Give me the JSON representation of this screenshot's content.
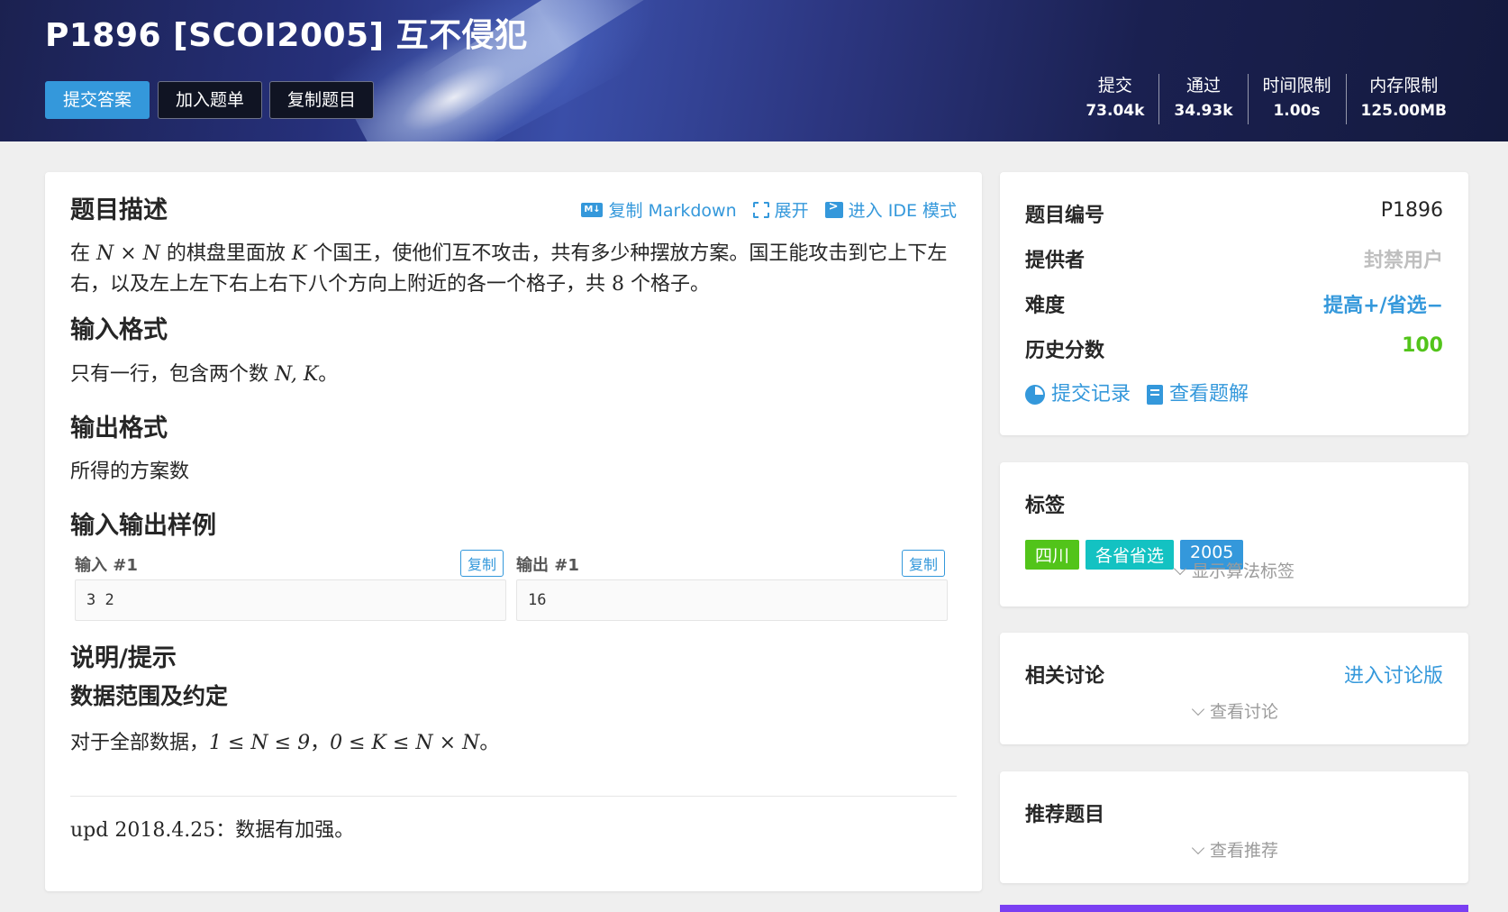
{
  "header": {
    "title": "P1896 [SCOI2005] 互不侵犯",
    "buttons": {
      "submit": "提交答案",
      "add_list": "加入题单",
      "copy": "复制题目"
    },
    "stats": [
      {
        "label": "提交",
        "value": "73.04k"
      },
      {
        "label": "通过",
        "value": "34.93k"
      },
      {
        "label": "时间限制",
        "value": "1.00s"
      },
      {
        "label": "内存限制",
        "value": "125.00MB"
      }
    ]
  },
  "main": {
    "toolbar": {
      "copy_markdown": "复制 Markdown",
      "expand": "展开",
      "ide": "进入 IDE 模式",
      "md_badge": "M↓"
    },
    "description_title": "题目描述",
    "description_line1_a": "在 ",
    "description_N1": "N",
    "description_times": " × ",
    "description_N2": "N",
    "description_line1_b": " 的棋盘里面放 ",
    "description_K": "K",
    "description_line1_c": " 个国王，使他们互不攻击，共有多少种摆放方案。国王能攻击到它上下左",
    "description_line2_a": "右，以及左上左下右上右下八个方向上附近的各一个格子，共 ",
    "description_8": "8",
    "description_line2_b": " 个格子。",
    "input_title": "输入格式",
    "input_text_a": "只有一行，包含两个数 ",
    "input_NK": "N, K",
    "input_text_b": "。",
    "output_title": "输出格式",
    "output_text": "所得的方案数",
    "samples_title": "输入输出样例",
    "sample_in_label": "输入 #1",
    "sample_out_label": "输出 #1",
    "copy_label": "复制",
    "sample_in": "3 2",
    "sample_out": "16",
    "hint_title": "说明/提示",
    "range_title": "数据范围及约定",
    "range_text_a": "对于全部数据，",
    "range_math1": "1 ≤ N ≤ 9",
    "range_sep": "，",
    "range_math2": "0 ≤ K ≤ N × N",
    "range_text_b": "。",
    "upd_a": "upd 2018.4.25",
    "upd_b": "：数据有加强。"
  },
  "side": {
    "info": {
      "pid_label": "题目编号",
      "pid": "P1896",
      "provider_label": "提供者",
      "provider": "封禁用户",
      "difficulty_label": "难度",
      "difficulty": "提高+/省选−",
      "score_label": "历史分数",
      "score": "100",
      "records": "提交记录",
      "solutions": "查看题解"
    },
    "tags": {
      "title": "标签",
      "items": [
        {
          "label": "四川",
          "color": "#52c41a"
        },
        {
          "label": "各省省选",
          "color": "#13c2c2"
        },
        {
          "label": "2005",
          "color": "#3498db"
        }
      ],
      "show_algo": "显示算法标签"
    },
    "discuss": {
      "title": "相关讨论",
      "enter": "进入讨论版",
      "view": "查看讨论"
    },
    "recommend": {
      "title": "推荐题目",
      "view": "查看推荐"
    }
  },
  "colors": {
    "accent": "#3498db",
    "score": "#52c41a",
    "purple": "#7a3ff2"
  }
}
